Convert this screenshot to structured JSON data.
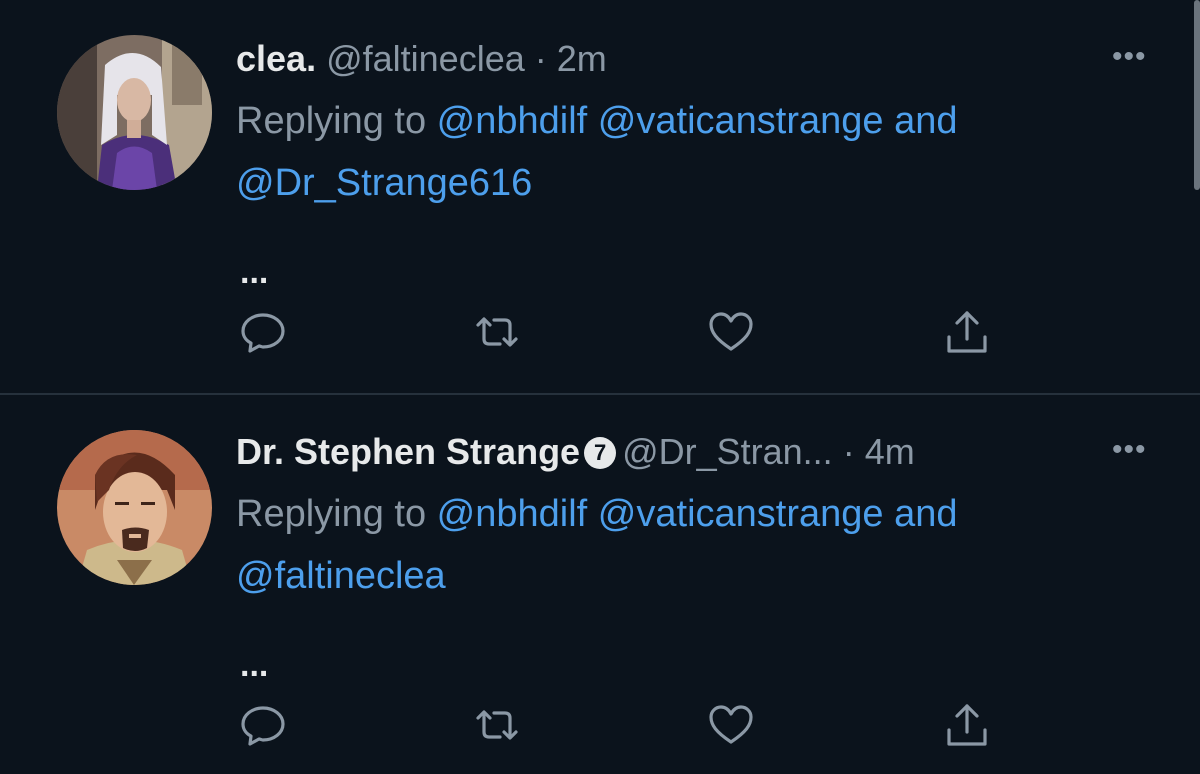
{
  "tweets": [
    {
      "name": "clea.",
      "handle": "@faltineclea",
      "separator": " · ",
      "time": "2m",
      "verified": false,
      "replying_label": "Replying to ",
      "mention1": "@nbhdilf",
      "mention2": "@vaticanstrange",
      "and_label": "and",
      "mention3": "@Dr_Strange616",
      "truncated": "...",
      "more": "•••"
    },
    {
      "name": "Dr. Stephen Strange",
      "verified_badge": "7",
      "handle": "@Dr_Stran...",
      "separator": " · ",
      "time": "4m",
      "verified": true,
      "replying_label": "Replying to ",
      "mention1": "@nbhdilf",
      "mention2": "@vaticanstrange",
      "and_label": "and",
      "mention3": "@faltineclea",
      "truncated": "...",
      "more": "•••"
    }
  ],
  "icons": [
    "reply-icon",
    "retweet-icon",
    "like-icon",
    "share-icon"
  ],
  "colors": {
    "background": "#0b131c",
    "mention": "#4d9fec",
    "secondary_text": "#8b98a5",
    "primary_text": "#e7e9ea"
  }
}
